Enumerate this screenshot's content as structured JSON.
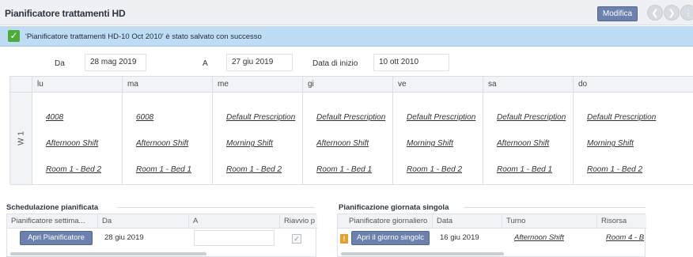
{
  "header": {
    "title": "Pianificatore trattamenti HD",
    "modify_label": "Modifica",
    "nav_icons": [
      "chevron-left-icon",
      "chevron-right-icon",
      "more-icon"
    ]
  },
  "notice": {
    "icon": "check-icon",
    "message": "'Pianificatore trattamenti HD-10 Oct 2010' è stato salvato con successo",
    "background": "#bfdcf5",
    "accent": "#4dab3a"
  },
  "filters": {
    "from_label": "Da",
    "from_value": "28 mag 2019",
    "to_label": "A",
    "to_value": "27 giu 2019",
    "start_label": "Data di inizio",
    "start_value": "10 ott 2010"
  },
  "schedule": {
    "week_label": "W 1",
    "days": [
      {
        "label": "lu",
        "prescription": "4008",
        "shift": "Afternoon Shift",
        "room": "Room 1 - Bed 2"
      },
      {
        "label": "ma",
        "prescription": "6008",
        "shift": "Afternoon Shift",
        "room": "Room 1 - Bed 1"
      },
      {
        "label": "me",
        "prescription": "Default Prescription",
        "shift": "Morning Shift",
        "room": "Room 1 - Bed 2"
      },
      {
        "label": "gi",
        "prescription": "Default Prescription",
        "shift": "Afternoon Shift",
        "room": "Room 1 - Bed 1"
      },
      {
        "label": "ve",
        "prescription": "Default Prescription",
        "shift": "Morning Shift",
        "room": "Room 1 - Bed 2"
      },
      {
        "label": "sa",
        "prescription": "Default Prescription",
        "shift": "Afternoon Shift",
        "room": "Room 1 - Bed 1"
      },
      {
        "label": "do",
        "prescription": "Default Prescription",
        "shift": "Morning Shift",
        "room": "Room 1 - Bed 2"
      }
    ]
  },
  "planned": {
    "title": "Schedulazione pianificata",
    "columns": [
      "Pianificatore settima...",
      "Da",
      "A",
      "Riavvio p"
    ],
    "row": {
      "button": "Apri Pianificatore",
      "from": "28 giu 2019",
      "to": "",
      "restart": true
    }
  },
  "single_day": {
    "title": "Pianificazione giornata singola",
    "columns": [
      "Pianificatore giornaliero",
      "Data",
      "Turno",
      "Risorsa"
    ],
    "row": {
      "warning": "!",
      "button": "Apri il giorno singolc",
      "date": "16 giu 2019",
      "shift": "Afternoon Shift",
      "resource": "Room 4 - B"
    }
  },
  "colors": {
    "primary_button": "#6c81ad",
    "header_bg": "#eef0f3",
    "grid_border": "#d9dee4"
  }
}
